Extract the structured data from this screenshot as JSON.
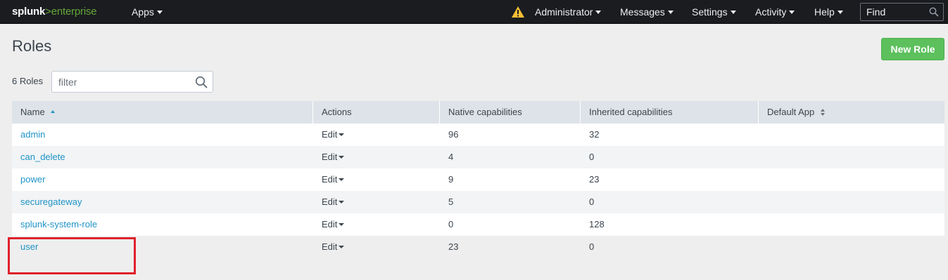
{
  "topbar": {
    "logo_main": "splunk",
    "logo_gt": ">",
    "logo_suffix": "enterprise",
    "apps_label": "Apps",
    "user_label": "Administrator",
    "messages_label": "Messages",
    "settings_label": "Settings",
    "activity_label": "Activity",
    "help_label": "Help",
    "find_placeholder": "Find",
    "warning_icon": "warning-triangle-icon",
    "warning_color": "#f8be34"
  },
  "page": {
    "title": "Roles",
    "new_role_label": "New Role",
    "count_label": "6 Roles",
    "filter_placeholder": "filter"
  },
  "table": {
    "columns": {
      "name": "Name",
      "actions": "Actions",
      "native": "Native capabilities",
      "inherited": "Inherited capabilities",
      "default_app": "Default App"
    },
    "rows": [
      {
        "name": "admin",
        "action": "Edit",
        "native": "96",
        "inherited": "32",
        "default_app": ""
      },
      {
        "name": "can_delete",
        "action": "Edit",
        "native": "4",
        "inherited": "0",
        "default_app": ""
      },
      {
        "name": "power",
        "action": "Edit",
        "native": "9",
        "inherited": "23",
        "default_app": ""
      },
      {
        "name": "securegateway",
        "action": "Edit",
        "native": "5",
        "inherited": "0",
        "default_app": ""
      },
      {
        "name": "splunk-system-role",
        "action": "Edit",
        "native": "0",
        "inherited": "128",
        "default_app": ""
      },
      {
        "name": "user",
        "action": "Edit",
        "native": "23",
        "inherited": "0",
        "default_app": ""
      }
    ]
  },
  "colors": {
    "topbar_bg": "#1a1c20",
    "brand_green": "#65a637",
    "button_green": "#5cc05c",
    "link_blue": "#1e93c6",
    "highlight_red": "#e0212b"
  }
}
